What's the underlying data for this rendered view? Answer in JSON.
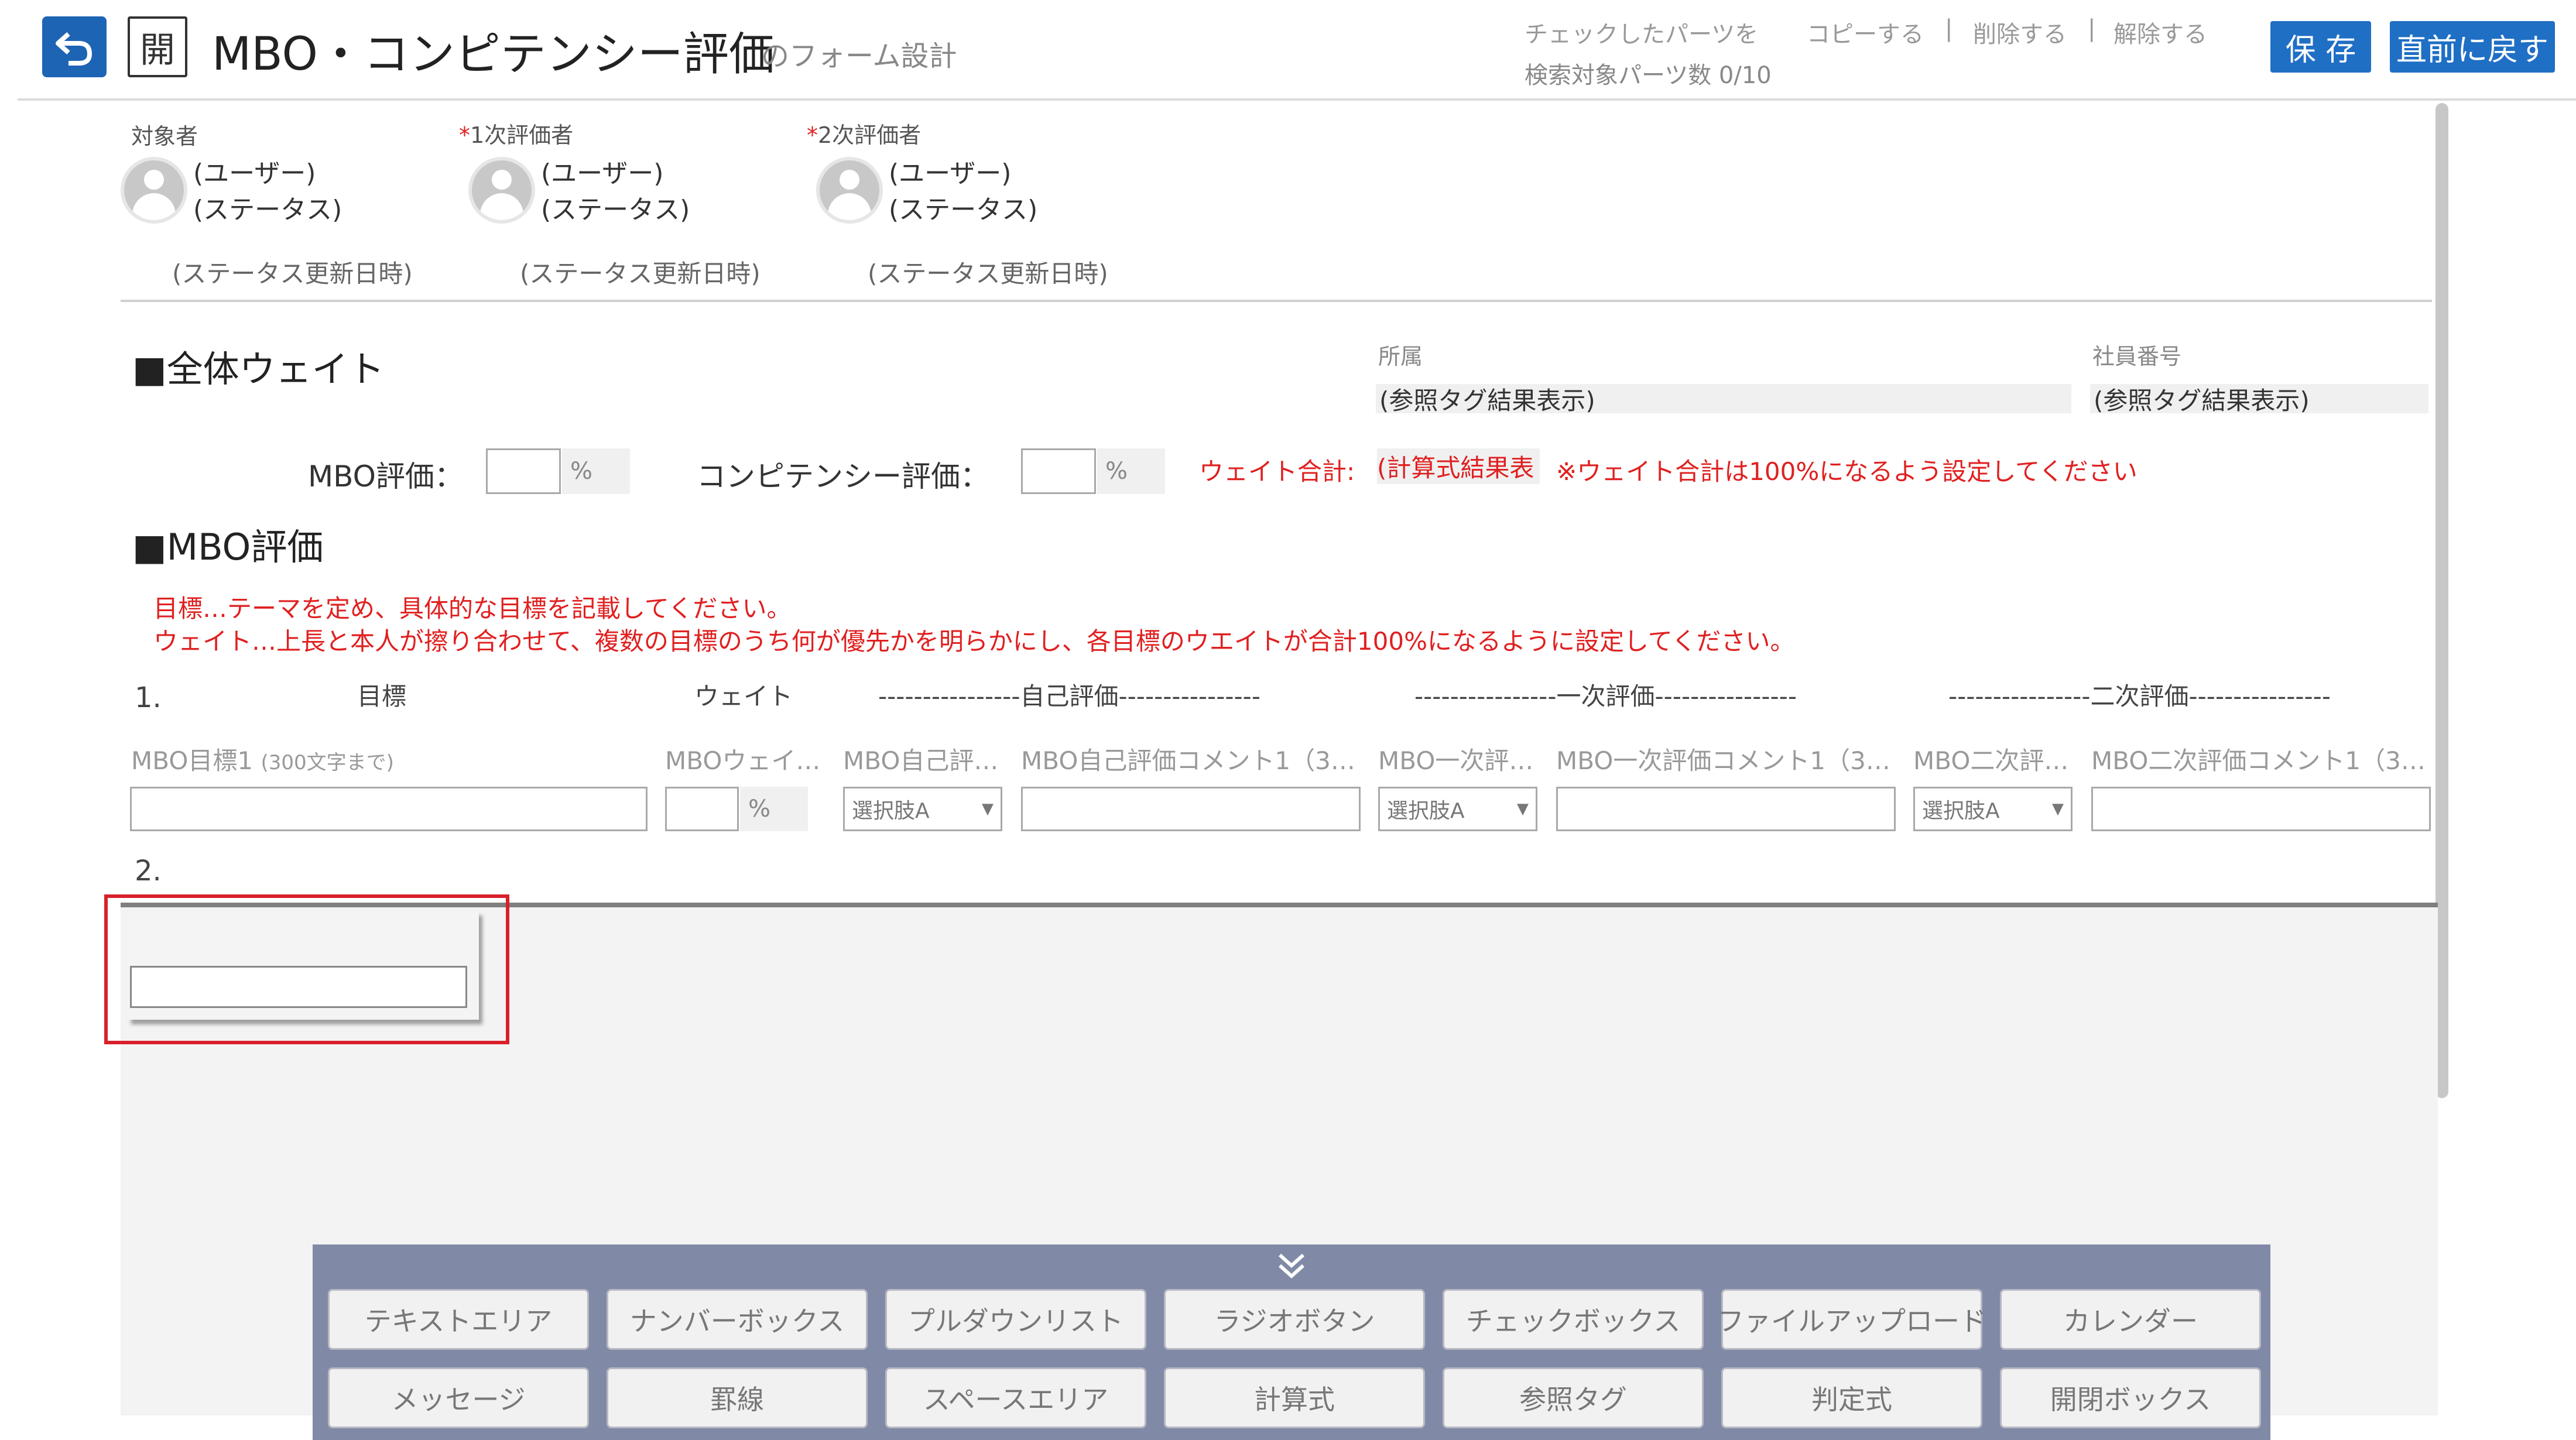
{
  "header": {
    "title": "MBO・コンピテンシー評価",
    "subtitle": "のフォーム設計",
    "open_label": "開",
    "checked_parts": "チェックしたパーツを",
    "copy": "コピーする",
    "delete": "削除する",
    "release": "解除する",
    "separator": "|",
    "search_count": "検索対象パーツ数 0/10",
    "save": "保 存",
    "revert": "直前に戻す"
  },
  "evaluators": [
    {
      "label": "対象者",
      "required": false,
      "user": "(ユーザー)",
      "status": "(ステータス)",
      "updated": "(ステータス更新日時)"
    },
    {
      "label": "1次評価者",
      "required": true,
      "user": "(ユーザー)",
      "status": "(ステータス)",
      "updated": "(ステータス更新日時)"
    },
    {
      "label": "2次評価者",
      "required": true,
      "user": "(ユーザー)",
      "status": "(ステータス)",
      "updated": "(ステータス更新日時)"
    }
  ],
  "required_mark": "*",
  "affiliation": {
    "label": "所属",
    "value": "(参照タグ結果表示)"
  },
  "employee_no": {
    "label": "社員番号",
    "value": "(参照タグ結果表示)"
  },
  "weights": {
    "heading": "■全体ウェイト",
    "mbo_label": "MBO評価：",
    "comp_label": "コンピテンシー評価：",
    "pct": "%",
    "total_label": "ウェイト合計:",
    "total_value": "(計算式結果表",
    "note": "※ウェイト合計は100%になるよう設定してください"
  },
  "mbo": {
    "heading": "■MBO評価",
    "instruction1": "目標…テーマを定め、具体的な目標を記載してください。",
    "instruction2": "ウェイト…上長と本人が擦り合わせて、複数の目標のうち何が優先かを明らかにし、各目標のウエイトが合計100%になるように設定してください。",
    "row1_no": "1.",
    "row2_no": "2.",
    "col_goal": "目標",
    "col_weight": "ウェイト",
    "col_self": "----------------自己評価----------------",
    "col_first": "----------------一次評価----------------",
    "col_second": "----------------二次評価----------------",
    "field_goal": "MBO目標1",
    "field_goal_limit": "(300文字まで)",
    "field_weight": "MBOウェイ…",
    "field_self": "MBO自己評…",
    "field_self_comment": "MBO自己評価コメント1（3…",
    "field_first": "MBO一次評…",
    "field_first_comment": "MBO一次評価コメント1（3…",
    "field_second": "MBO二次評…",
    "field_second_comment": "MBO二次評価コメント1（3…",
    "select_value": "選択肢A",
    "select_arrow": "▼"
  },
  "palette": {
    "row1": [
      "テキストエリア",
      "ナンバーボックス",
      "プルダウンリスト",
      "ラジオボタン",
      "チェックボックス",
      "ファイルアップロード",
      "カレンダー"
    ],
    "row2": [
      "メッセージ",
      "罫線",
      "スペースエリア",
      "計算式",
      "参照タグ",
      "判定式",
      "開閉ボックス"
    ]
  },
  "colors": {
    "accent": "#1f6fc5",
    "required": "#e02020",
    "palette_bg": "#808aa6",
    "highlight": "#d9202a"
  }
}
